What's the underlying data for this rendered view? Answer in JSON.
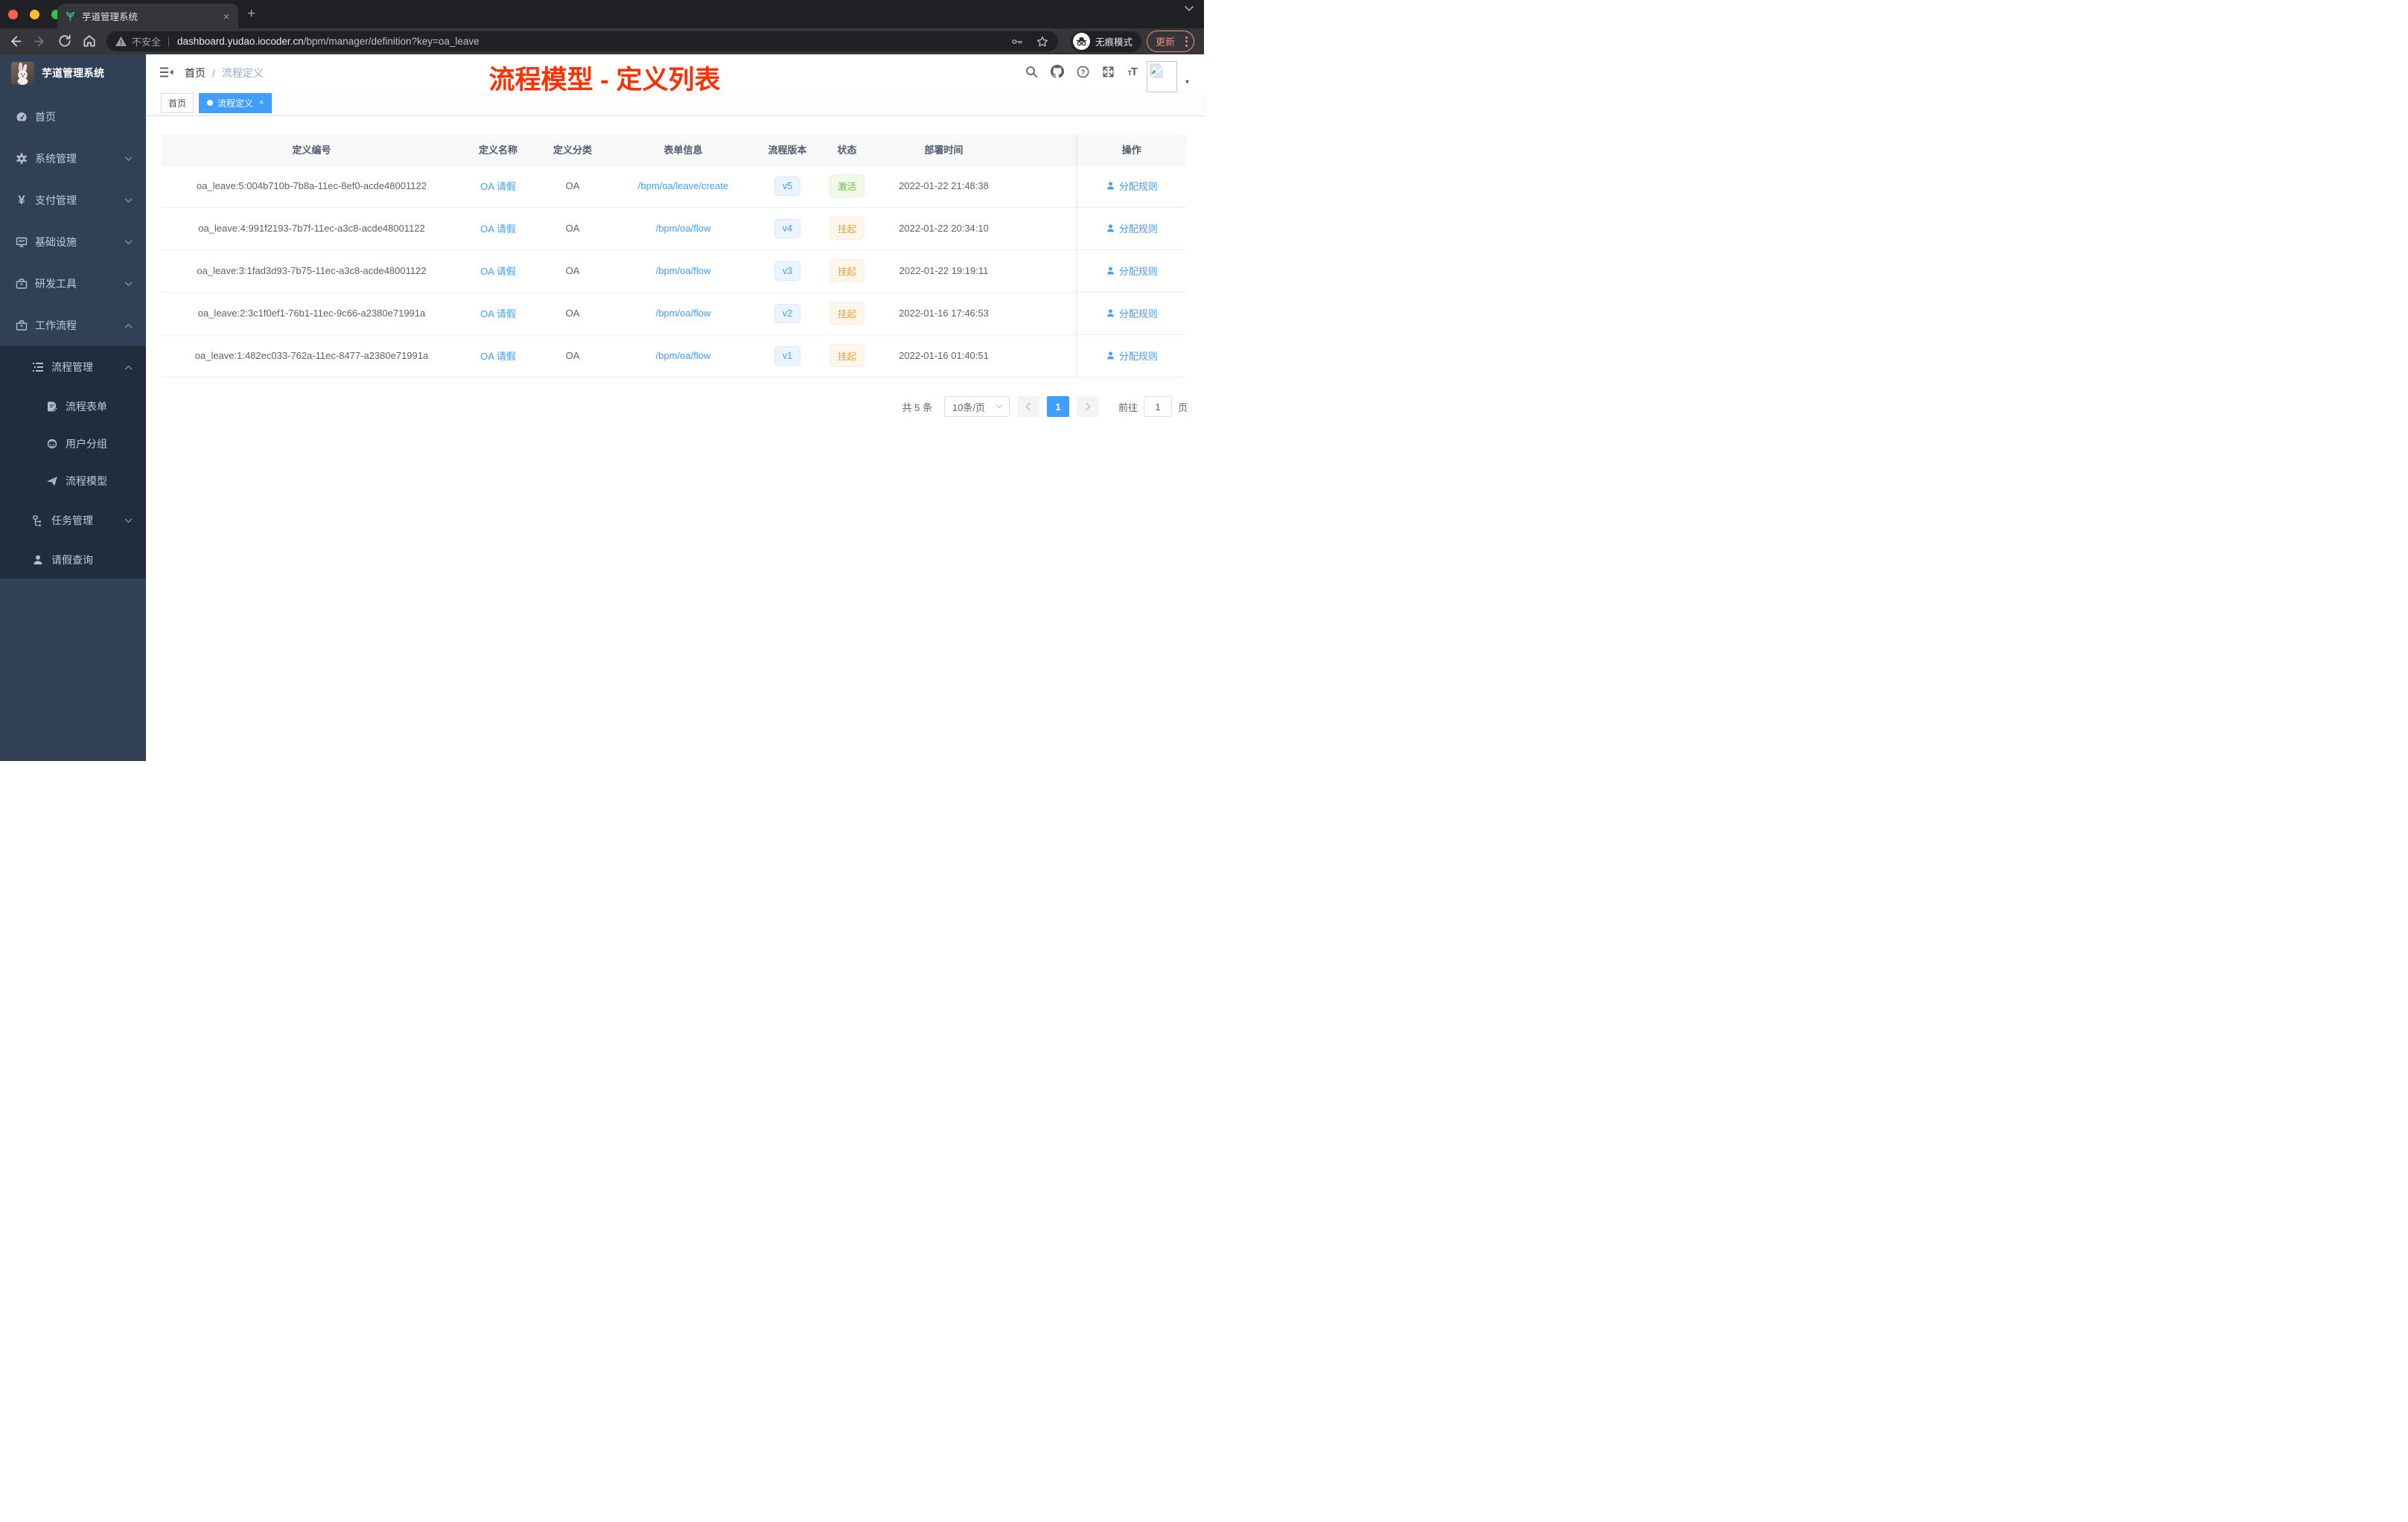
{
  "colors": {
    "primary": "#409eff",
    "success": "#67c23a",
    "warning": "#e6a23c",
    "annotation_red": "#ff3000",
    "sidebar_bg": "#304156",
    "submenu_bg": "#1f2d3d"
  },
  "icons": {
    "tab_close": "×",
    "new_tab": "+",
    "active_dot": "●",
    "tag_close": "×",
    "caret_down": "▾",
    "breadcrumb_sep": "/",
    "font_size_small": "т",
    "font_size_big": "T"
  },
  "browser": {
    "tab_title": "芋道管理系统",
    "security_label": "不安全",
    "url_domain": "dashboard.yudao.iocoder.cn",
    "url_path": "/bpm/manager/definition?key=oa_leave",
    "incognito_label": "无痕模式",
    "update_label": "更新"
  },
  "sidebar": {
    "logo_title": "芋道管理系统",
    "items": [
      {
        "label": "首页"
      },
      {
        "label": "系统管理"
      },
      {
        "label": "支付管理"
      },
      {
        "label": "基础设施"
      },
      {
        "label": "研发工具"
      },
      {
        "label": "工作流程"
      },
      {
        "label": "流程管理"
      },
      {
        "label": "流程表单"
      },
      {
        "label": "用户分组"
      },
      {
        "label": "流程模型"
      },
      {
        "label": "任务管理"
      },
      {
        "label": "请假查询"
      }
    ],
    "yen_glyph": "¥"
  },
  "header": {
    "breadcrumb_home": "首页",
    "breadcrumb_current": "流程定义",
    "annotation": "流程模型 - 定义列表"
  },
  "tags_view": {
    "home_tab": "首页",
    "active_tab": "流程定义"
  },
  "table": {
    "headers": {
      "id": "定义编号",
      "name": "定义名称",
      "category": "定义分类",
      "form": "表单信息",
      "version": "流程版本",
      "status": "状态",
      "deploy_time": "部署时间",
      "actions": "操作"
    },
    "rows": [
      {
        "id": "oa_leave:5:004b710b-7b8a-11ec-8ef0-acde48001122",
        "name": "OA 请假",
        "category": "OA",
        "form": "/bpm/oa/leave/create",
        "version": "v5",
        "status": "激活",
        "time": "2022-01-22 21:48:38",
        "action": "分配规则"
      },
      {
        "id": "oa_leave:4:991f2193-7b7f-11ec-a3c8-acde48001122",
        "name": "OA 请假",
        "category": "OA",
        "form": "/bpm/oa/flow",
        "version": "v4",
        "status": "挂起",
        "time": "2022-01-22 20:34:10",
        "action": "分配规则"
      },
      {
        "id": "oa_leave:3:1fad3d93-7b75-11ec-a3c8-acde48001122",
        "name": "OA 请假",
        "category": "OA",
        "form": "/bpm/oa/flow",
        "version": "v3",
        "status": "挂起",
        "time": "2022-01-22 19:19:11",
        "action": "分配规则"
      },
      {
        "id": "oa_leave:2:3c1f0ef1-76b1-11ec-9c66-a2380e71991a",
        "name": "OA 请假",
        "category": "OA",
        "form": "/bpm/oa/flow",
        "version": "v2",
        "status": "挂起",
        "time": "2022-01-16 17:46:53",
        "action": "分配规则"
      },
      {
        "id": "oa_leave:1:482ec033-762a-11ec-8477-a2380e71991a",
        "name": "OA 请假",
        "category": "OA",
        "form": "/bpm/oa/flow",
        "version": "v1",
        "status": "挂起",
        "time": "2022-01-16 01:40:51",
        "action": "分配规则"
      }
    ]
  },
  "pagination": {
    "total": "共 5 条",
    "page_size": "10条/页",
    "current_page": "1",
    "goto_label": "前往",
    "goto_value": "1",
    "page_unit": "页"
  }
}
